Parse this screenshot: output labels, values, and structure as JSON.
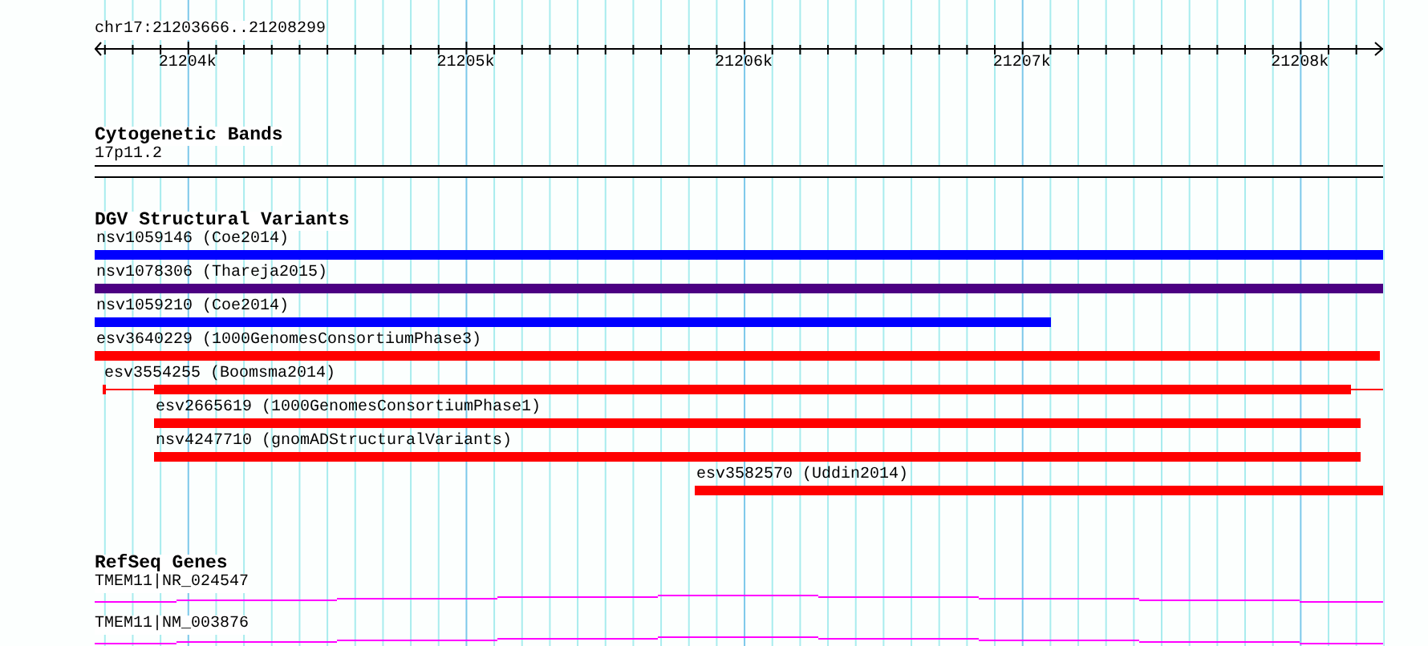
{
  "region": {
    "title": "chr17:21203666..21208299"
  },
  "axis": {
    "labels": [
      "21204k",
      "21205k",
      "21206k",
      "21207k",
      "21208k"
    ]
  },
  "tracks": [
    {
      "kind": "bands",
      "title": "Cytogenetic Bands",
      "label": "17p11.2"
    },
    {
      "kind": "variants",
      "title": "DGV Structural Variants",
      "features": [
        {
          "label": "nsv1059146 (Coe2014)",
          "color": "#0000ff"
        },
        {
          "label": "nsv1078306 (Thareja2015)",
          "color": "#4b0082"
        },
        {
          "label": "nsv1059210 (Coe2014)",
          "color": "#0000ff"
        },
        {
          "label": "esv3640229 (1000GenomesConsortiumPhase3)",
          "color": "#ff0000"
        },
        {
          "label": "esv3554255 (Boomsma2014)",
          "color": "#ff0000"
        },
        {
          "label": "esv2665619 (1000GenomesConsortiumPhase1)",
          "color": "#ff0000"
        },
        {
          "label": "nsv4247710 (gnomADStructuralVariants)",
          "color": "#ff0000"
        },
        {
          "label": "esv3582570 (Uddin2014)",
          "color": "#ff0000"
        }
      ]
    },
    {
      "kind": "genes",
      "title": "RefSeq Genes",
      "genes": [
        {
          "label": "TMEM11|NR_024547"
        },
        {
          "label": "TMEM11|NM_003876"
        }
      ]
    }
  ]
}
